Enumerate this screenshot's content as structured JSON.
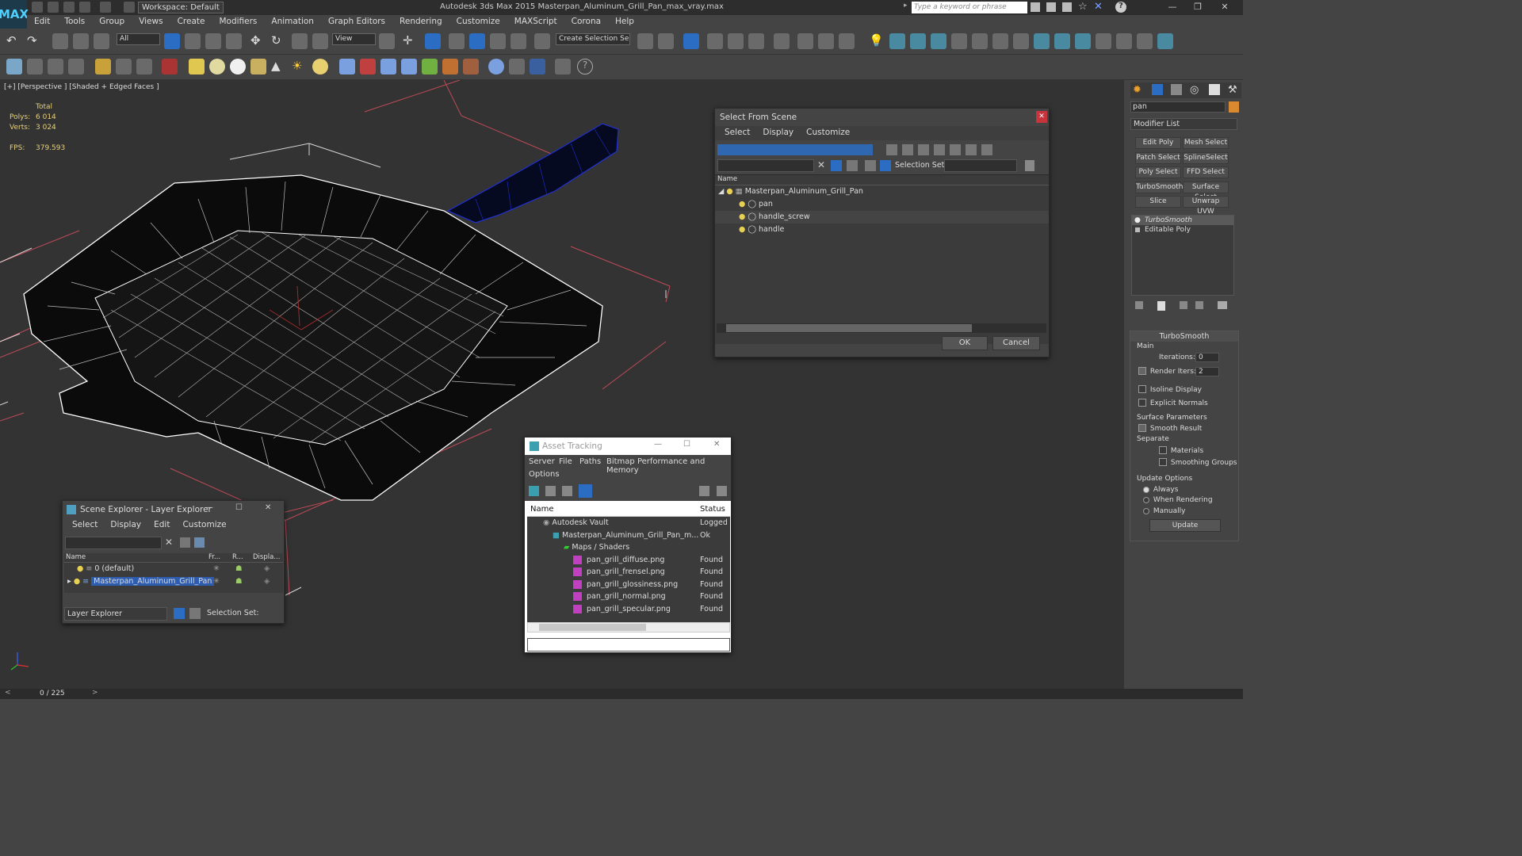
{
  "app": {
    "title": "Autodesk 3ds Max  2015     Masterpan_Aluminum_Grill_Pan_max_vray.max",
    "logo": "MAX",
    "workspace": "Workspace: Default",
    "search_placeholder": "Type a keyword or phrase"
  },
  "menu": [
    "Edit",
    "Tools",
    "Group",
    "Views",
    "Create",
    "Modifiers",
    "Animation",
    "Graph Editors",
    "Rendering",
    "Customize",
    "MAXScript",
    "Corona",
    "Help"
  ],
  "toolbar": {
    "selection_filter": "All",
    "ref_coord": "View",
    "named_selection": "Create Selection Se"
  },
  "viewport": {
    "label": "[+] [Perspective ] [Shaded + Edged Faces ]",
    "stats": {
      "total_label": "Total",
      "polys_label": "Polys:",
      "polys": "6 014",
      "verts_label": "Verts:",
      "verts": "3 024",
      "fps_label": "FPS:",
      "fps": "379.593"
    }
  },
  "select_from_scene": {
    "title": "Select From Scene",
    "menu": [
      "Select",
      "Display",
      "Customize"
    ],
    "selection_set_label": "Selection Set:",
    "column_name": "Name",
    "root": "Masterpan_Aluminum_Grill_Pan",
    "children": [
      "pan",
      "handle_screw",
      "handle"
    ],
    "ok": "OK",
    "cancel": "Cancel"
  },
  "scene_explorer": {
    "title": "Scene Explorer - Layer Explorer",
    "menu": [
      "Select",
      "Display",
      "Edit",
      "Customize"
    ],
    "columns": [
      "Name",
      "Fr...",
      "R...",
      "Displa..."
    ],
    "rows": [
      "0 (default)",
      "Masterpan_Aluminum_Grill_Pan"
    ],
    "footer_dropdown": "Layer Explorer",
    "selection_set_label": "Selection Set:"
  },
  "asset_tracking": {
    "title": "Asset Tracking",
    "menu": [
      "Server",
      "File",
      "Paths",
      "Bitmap Performance and Memory"
    ],
    "menu2": "Options",
    "columns": [
      "Name",
      "Status"
    ],
    "rows": [
      {
        "name": "Autodesk Vault",
        "status": "Logged"
      },
      {
        "name": "Masterpan_Aluminum_Grill_Pan_m...",
        "status": "Ok"
      },
      {
        "name": "Maps / Shaders",
        "status": ""
      },
      {
        "name": "pan_grill_diffuse.png",
        "status": "Found"
      },
      {
        "name": "pan_grill_frensel.png",
        "status": "Found"
      },
      {
        "name": "pan_grill_glossiness.png",
        "status": "Found"
      },
      {
        "name": "pan_grill_normal.png",
        "status": "Found"
      },
      {
        "name": "pan_grill_specular.png",
        "status": "Found"
      }
    ]
  },
  "command_panel": {
    "object_name": "pan",
    "modifier_list": "Modifier List",
    "buttons": [
      "Edit Poly",
      "Mesh Select",
      "Patch Select",
      "SplineSelect",
      "Poly Select",
      "FFD Select",
      "TurboSmooth",
      "Surface Select",
      "Slice",
      "Unwrap UVW"
    ],
    "stack": [
      "TurboSmooth",
      "Editable Poly"
    ],
    "rollout_title": "TurboSmooth",
    "main_label": "Main",
    "iterations_label": "Iterations:",
    "iterations": "0",
    "render_iters_label": "Render Iters:",
    "render_iters": "2",
    "isoline": "Isoline Display",
    "explicit_normals": "Explicit Normals",
    "surface_params": "Surface Parameters",
    "smooth_result": "Smooth Result",
    "separate": "Separate",
    "materials": "Materials",
    "smoothing_groups": "Smoothing Groups",
    "update_options": "Update Options",
    "always": "Always",
    "when_rendering": "When Rendering",
    "manually": "Manually",
    "update": "Update"
  },
  "status": {
    "frame": "0 / 225"
  }
}
